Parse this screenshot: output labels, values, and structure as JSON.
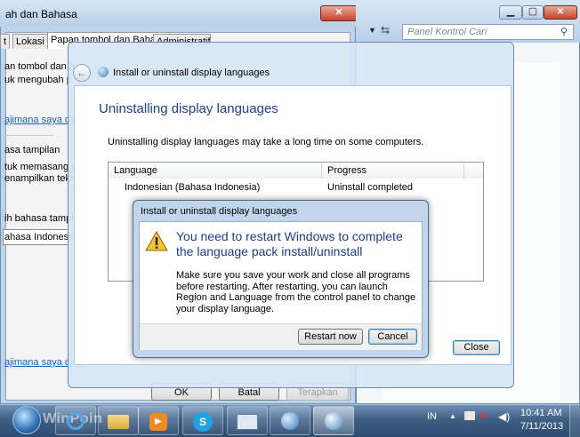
{
  "region_window": {
    "title": "ah dan Bahasa",
    "tabs": [
      "t",
      "Lokasi",
      "Papan tombol dan Bahasa",
      "Administratif"
    ],
    "line1": "an tombol dan b",
    "line2": "uk mengubah p",
    "link1": "ajimana saya dap",
    "section_label": "asa tampilan",
    "line3": "tuk memasang a",
    "line4": "enampilkan teks",
    "line5": "ih bahasa tampil",
    "select_value": "ahasa Indonesia",
    "link2": "ajimana saya dap",
    "ok": "OK",
    "cancel": "Batal",
    "apply": "Terapkan"
  },
  "control_panel": {
    "search_placeholder": "Panel Kontrol Cari"
  },
  "main_dialog": {
    "nav_title": "Install or uninstall display languages",
    "heading": "Uninstalling display languages",
    "info": "Uninstalling display languages may take a long time on some computers.",
    "columns": [
      "Language",
      "Progress"
    ],
    "rows": [
      {
        "language": "Indonesian (Bahasa Indonesia)",
        "progress": "Uninstall completed"
      }
    ],
    "close": "Close"
  },
  "modal": {
    "title": "Install or uninstall display languages",
    "heading": "You need to restart Windows to complete the language pack install/uninstall",
    "body": "Make sure you save your work and close all programs before restarting. After restarting, you can launch Region and Language from the control panel to change your display language.",
    "restart": "Restart now",
    "cancel": "Cancel"
  },
  "taskbar": {
    "watermark": "WinPoin",
    "lang": "IN",
    "time": "10:41 AM",
    "date": "7/11/2013"
  },
  "colors": {
    "heading_blue": "#1e3d8a",
    "link_blue": "#1a5fb4",
    "warning_yellow": "#f2c230"
  }
}
